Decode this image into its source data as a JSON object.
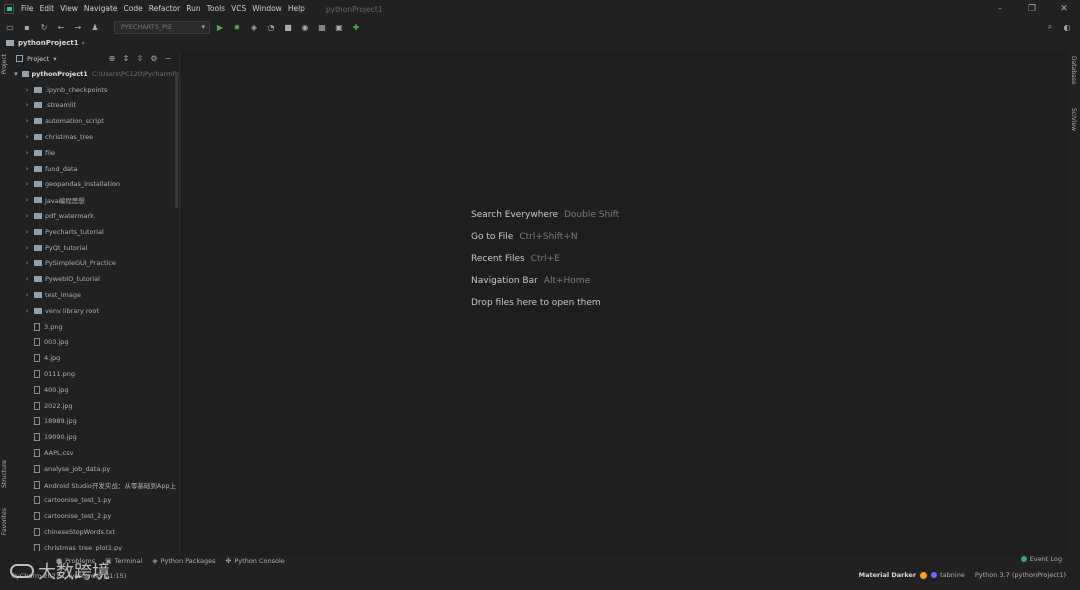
{
  "titlebar": {
    "menu": [
      "File",
      "Edit",
      "View",
      "Navigate",
      "Code",
      "Refactor",
      "Run",
      "Tools",
      "VCS",
      "Window",
      "Help"
    ],
    "project_title": "pythonProject1"
  },
  "toolbar": {
    "run_config": "PYECHARTS_PIE"
  },
  "breadcrumb": {
    "project": "pythonProject1"
  },
  "left_strip": {
    "project": "Project",
    "structure": "Structure",
    "favorites": "Favorites"
  },
  "project_panel": {
    "title": "Project",
    "root_name": "pythonProject1",
    "root_path": "C:\\Users\\PC120\\PycharmPr",
    "folders": [
      ".ipynb_checkpoints",
      ".streamlit",
      "automation_script",
      "christmas_tree",
      "file",
      "fund_data",
      "geopandas_installation",
      "Java编程思想",
      "pdf_watermark",
      "Pyecharts_tutorial",
      "PyQt_tutorial",
      "PySimpleGUI_Practice",
      "PywebIO_tutorial",
      "test_image",
      "venv  library root"
    ],
    "files": [
      "3.png",
      "003.jpg",
      "4.jpg",
      "0111.png",
      "400.jpg",
      "2022.jpg",
      "18989.jpg",
      "19090.jpg",
      "AAPL.csv",
      "analyse_job_data.py",
      "Android Studio开发实战：从零基础到App上",
      "cartoonise_test_1.py",
      "cartoonise_test_2.py",
      "chineseStopWords.txt",
      "christmas_tree_plot1.py"
    ]
  },
  "editor_hints": [
    {
      "action": "Search Everywhere",
      "key": "Double Shift"
    },
    {
      "action": "Go to File",
      "key": "Ctrl+Shift+N"
    },
    {
      "action": "Recent Files",
      "key": "Ctrl+E"
    },
    {
      "action": "Navigation Bar",
      "key": "Alt+Home"
    },
    {
      "action": "Drop files here to open them",
      "key": ""
    }
  ],
  "right_strip": {
    "database": "Database",
    "sciview": "SciView"
  },
  "bottom_tabs": {
    "problems": "Problems",
    "terminal": "Terminal",
    "python_packages": "Python Packages",
    "python_console": "Python Console",
    "event_log": "Event Log"
  },
  "statusbar": {
    "message": "PyCharm 2021... (yesterday 21:15)",
    "theme": "Material Darker",
    "tabnine": "tabnine",
    "interpreter": "Python 3.7 (pythonProject1)"
  },
  "watermark": {
    "text": "大数跨境"
  }
}
